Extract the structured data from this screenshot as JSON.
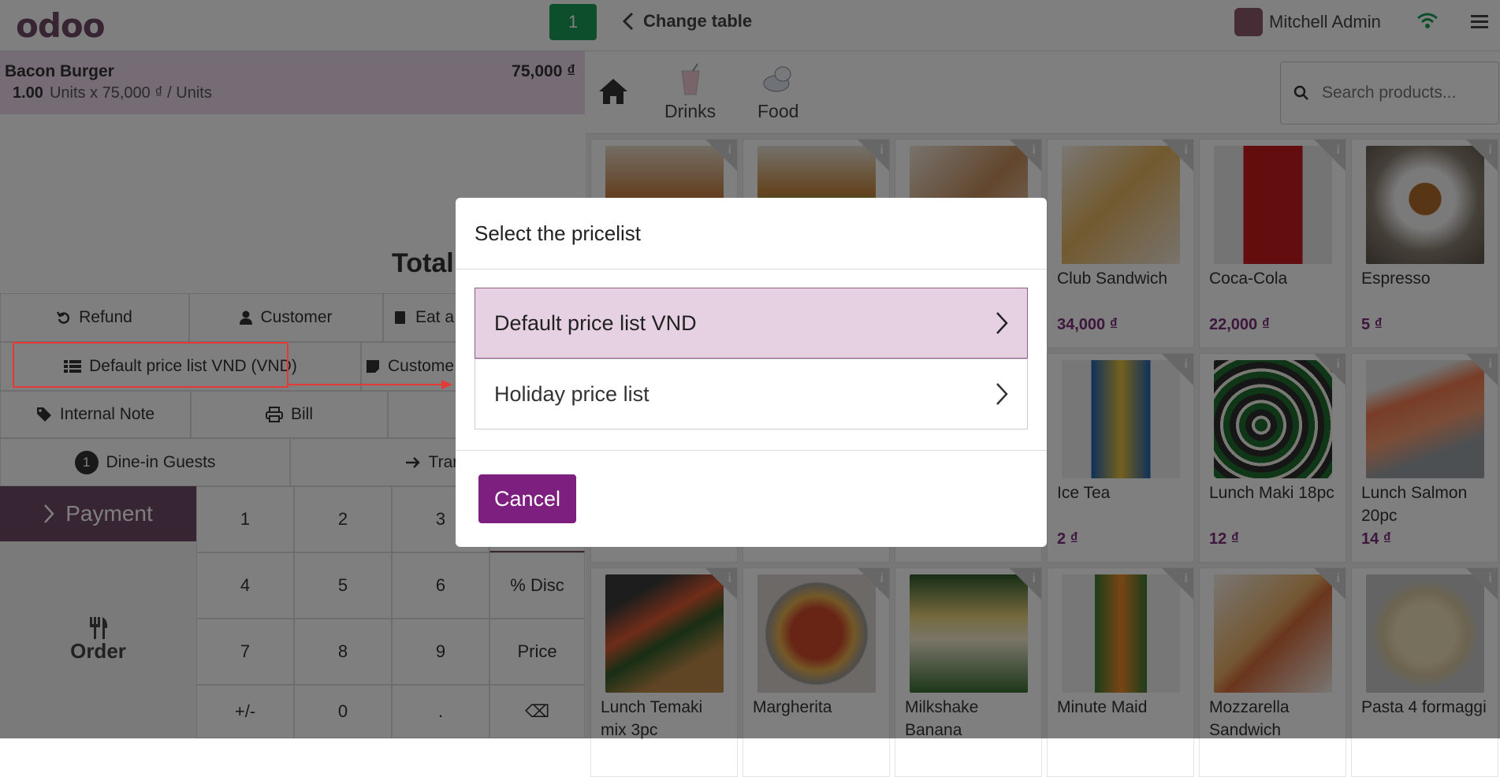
{
  "header": {
    "logo": "odoo",
    "table_number": "1",
    "change_table": "Change table",
    "user_name": "Mitchell Admin"
  },
  "order": {
    "line_name": "Bacon Burger",
    "line_price": "75,000 ₫",
    "line_qty": "1.00",
    "line_detail": "Units x 75,000 ₫ / Units",
    "total_label": "Total:"
  },
  "controls": {
    "refund": "Refund",
    "customer": "Customer",
    "eat_in": "Eat a",
    "pricelist": "Default price list VND (VND)",
    "customer_note": "Custome",
    "internal_note": "Internal Note",
    "bill": "Bill",
    "guests_count": "1",
    "guests": "Dine-in Guests",
    "transfer": "Trans",
    "payment": "Payment",
    "order": "Order"
  },
  "numpad": {
    "keys": [
      "1",
      "2",
      "3",
      "4",
      "5",
      "6",
      "% Disc",
      "7",
      "8",
      "9",
      "Price",
      "+/-",
      "0",
      ".",
      "⌫"
    ]
  },
  "categories": {
    "drinks": "Drinks",
    "food": "Food"
  },
  "search": {
    "placeholder": "Search products..."
  },
  "products": [
    {
      "name": "Club Sandwich",
      "price": "34,000 ₫"
    },
    {
      "name": "Coca-Cola",
      "price": "22,000 ₫"
    },
    {
      "name": "Espresso",
      "price": "5 ₫"
    },
    {
      "name": "Ice Tea",
      "price": "2 ₫"
    },
    {
      "name": "Lunch Maki 18pc",
      "price": "12 ₫"
    },
    {
      "name": "Lunch Salmon 20pc",
      "price": "14 ₫"
    },
    {
      "name": "Lunch Temaki mix 3pc",
      "price": ""
    },
    {
      "name": "Margherita",
      "price": ""
    },
    {
      "name": "Milkshake Banana",
      "price": ""
    },
    {
      "name": "Minute Maid",
      "price": ""
    },
    {
      "name": "Mozzarella Sandwich",
      "price": ""
    },
    {
      "name": "Pasta 4 formaggi",
      "price": ""
    }
  ],
  "dialog": {
    "title": "Select the pricelist",
    "options": [
      "Default price list VND",
      "Holiday price list"
    ],
    "cancel": "Cancel"
  },
  "colors": {
    "brand": "#714b67",
    "table_badge": "#1b9e5a",
    "price": "#7b2f7b",
    "selected_option": "#e6d1e3",
    "annotation": "#e53935"
  }
}
